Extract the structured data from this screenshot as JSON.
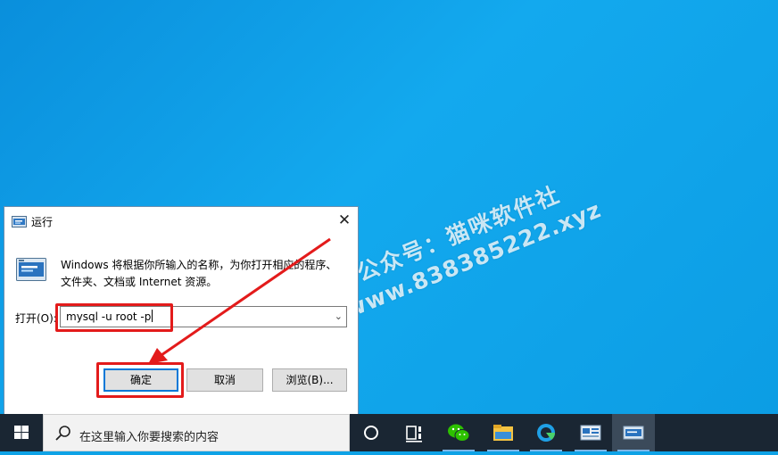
{
  "desktop": {
    "watermark_line1": "公众号：猫咪软件社",
    "watermark_line2": "www.838385222.xyz"
  },
  "dialog": {
    "title": "运行",
    "close": "✕",
    "description": "Windows 将根据你所输入的名称，为你打开相应的程序、文件夹、文档或 Internet 资源。",
    "open_label": "打开(O):",
    "input_value": "mysql -u root -p",
    "ok_label": "确定",
    "cancel_label": "取消",
    "browse_label": "浏览(B)..."
  },
  "taskbar": {
    "search_placeholder": "在这里输入你要搜索的内容",
    "icons": [
      "windows-start-icon",
      "cortana-icon",
      "task-view-icon",
      "wechat-icon",
      "file-explorer-icon",
      "edge-icon",
      "control-panel-icon",
      "run-app-icon"
    ]
  },
  "colors": {
    "desktop": "#0ea2e6",
    "taskbar": "#1a2633",
    "highlight": "#e31b1b",
    "focus": "#0078d7"
  }
}
